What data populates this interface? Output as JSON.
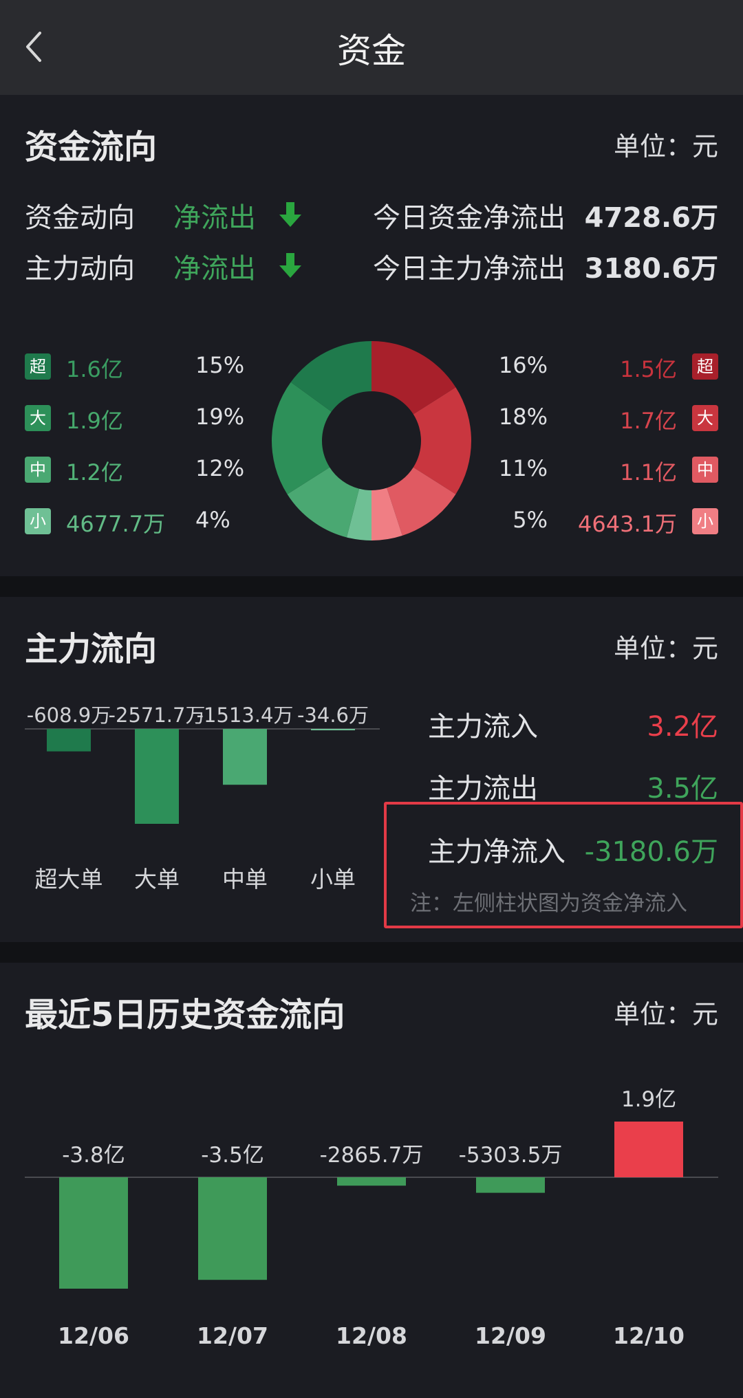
{
  "header": {
    "title": "资金",
    "back_icon": "chevron-left-icon"
  },
  "fund_flow": {
    "title": "资金流向",
    "unit": "单位：元",
    "fund_direction_label": "资金动向",
    "fund_direction_value": "净流出",
    "main_direction_label": "主力动向",
    "main_direction_value": "净流出",
    "today_fund_net_label": "今日资金净流出",
    "today_fund_net_value": "4728.6万",
    "today_main_net_label": "今日主力净流出",
    "today_main_net_value": "3180.6万",
    "outflow": [
      {
        "badge": "超",
        "amount": "1.6亿",
        "pct": "15%",
        "color": "#1f7a4c"
      },
      {
        "badge": "大",
        "amount": "1.9亿",
        "pct": "19%",
        "color": "#2d9059"
      },
      {
        "badge": "中",
        "amount": "1.2亿",
        "pct": "12%",
        "color": "#4aa872"
      },
      {
        "badge": "小",
        "amount": "4677.7万",
        "pct": "4%",
        "color": "#6fc095"
      }
    ],
    "inflow": [
      {
        "badge": "超",
        "amount": "1.5亿",
        "pct": "16%",
        "color": "#a8202b"
      },
      {
        "badge": "大",
        "amount": "1.7亿",
        "pct": "18%",
        "color": "#c9363f"
      },
      {
        "badge": "中",
        "amount": "1.1亿",
        "pct": "11%",
        "color": "#e05a62"
      },
      {
        "badge": "小",
        "amount": "4643.1万",
        "pct": "5%",
        "color": "#f07e84"
      }
    ]
  },
  "main_flow": {
    "title": "主力流向",
    "unit": "单位：元",
    "inflow_label": "主力流入",
    "inflow_value": "3.2亿",
    "outflow_label": "主力流出",
    "outflow_value": "3.5亿",
    "net_label": "主力净流入",
    "net_value": "-3180.6万",
    "note": "注：左侧柱状图为资金净流入"
  },
  "history": {
    "title": "最近5日历史资金流向",
    "unit": "单位：元"
  },
  "chart_data": [
    {
      "type": "pie",
      "categories": [
        "超",
        "大",
        "中",
        "小",
        "超",
        "大",
        "中",
        "小"
      ],
      "values": [
        16,
        18,
        11,
        5,
        4,
        12,
        19,
        15
      ],
      "colors": [
        "#a8202b",
        "#c9363f",
        "#e05a62",
        "#f07e84",
        "#6fc095",
        "#4aa872",
        "#2d9059",
        "#1f7a4c"
      ]
    },
    {
      "type": "bar",
      "categories": [
        "超大单",
        "大单",
        "中单",
        "小单"
      ],
      "values": [
        -608.9,
        -2571.7,
        -1513.4,
        -34.6
      ],
      "labels": [
        "-608.9万",
        "-2571.7万",
        "-1513.4万",
        "-34.6万"
      ],
      "colors": [
        "#1f7a4c",
        "#2d9059",
        "#4aa872",
        "#6fc095"
      ]
    },
    {
      "type": "bar",
      "categories": [
        "12/06",
        "12/07",
        "12/08",
        "12/09",
        "12/10"
      ],
      "values": [
        -38000,
        -35000,
        -2865.7,
        -5303.5,
        19000
      ],
      "labels": [
        "-3.8亿",
        "-3.5亿",
        "-2865.7万",
        "-5303.5万",
        "1.9亿"
      ],
      "colors": {
        "positive": "#ea3f4b",
        "negative": "#3f9a59"
      }
    }
  ]
}
